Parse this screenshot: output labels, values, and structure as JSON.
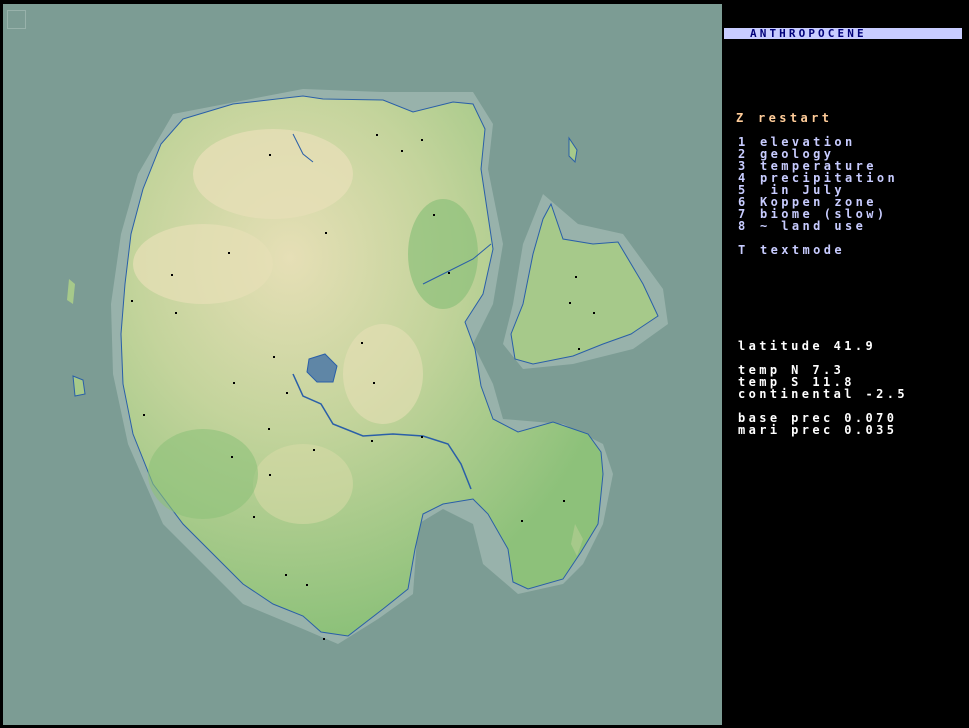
{
  "app": {
    "title": "ANTHROPOCENE"
  },
  "controls": {
    "restart": {
      "key": "Z",
      "label": "restart"
    },
    "modes": [
      {
        "key": "1",
        "label": "elevation"
      },
      {
        "key": "2",
        "label": "geology"
      },
      {
        "key": "3",
        "label": "temperature"
      },
      {
        "key": "4",
        "label": "precipitation"
      },
      {
        "key": "5",
        "label": " in July"
      },
      {
        "key": "6",
        "label": "Koppen zone"
      },
      {
        "key": "7",
        "label": "biome (slow)"
      },
      {
        "key": "8",
        "label": "~ land use"
      }
    ],
    "textmode": {
      "key": "T",
      "label": "textmode"
    }
  },
  "stats": {
    "latitude": "latitude 41.9",
    "temp_n": "temp N 7.3",
    "temp_s": "temp S 11.8",
    "continental": "continental -2.5",
    "base_prec": "base prec 0.070",
    "mari_prec": "mari prec 0.035"
  },
  "colors": {
    "ocean": "#7c9c94",
    "shallow": "#98b2ab",
    "lowland": "#8dc17a",
    "upland": "#c4d49c",
    "mountain": "#e6dfb6",
    "river": "#2a5fa8",
    "settlement": "#000000",
    "panel_text": "#c8ccff",
    "highlight": "#ffcc99"
  }
}
